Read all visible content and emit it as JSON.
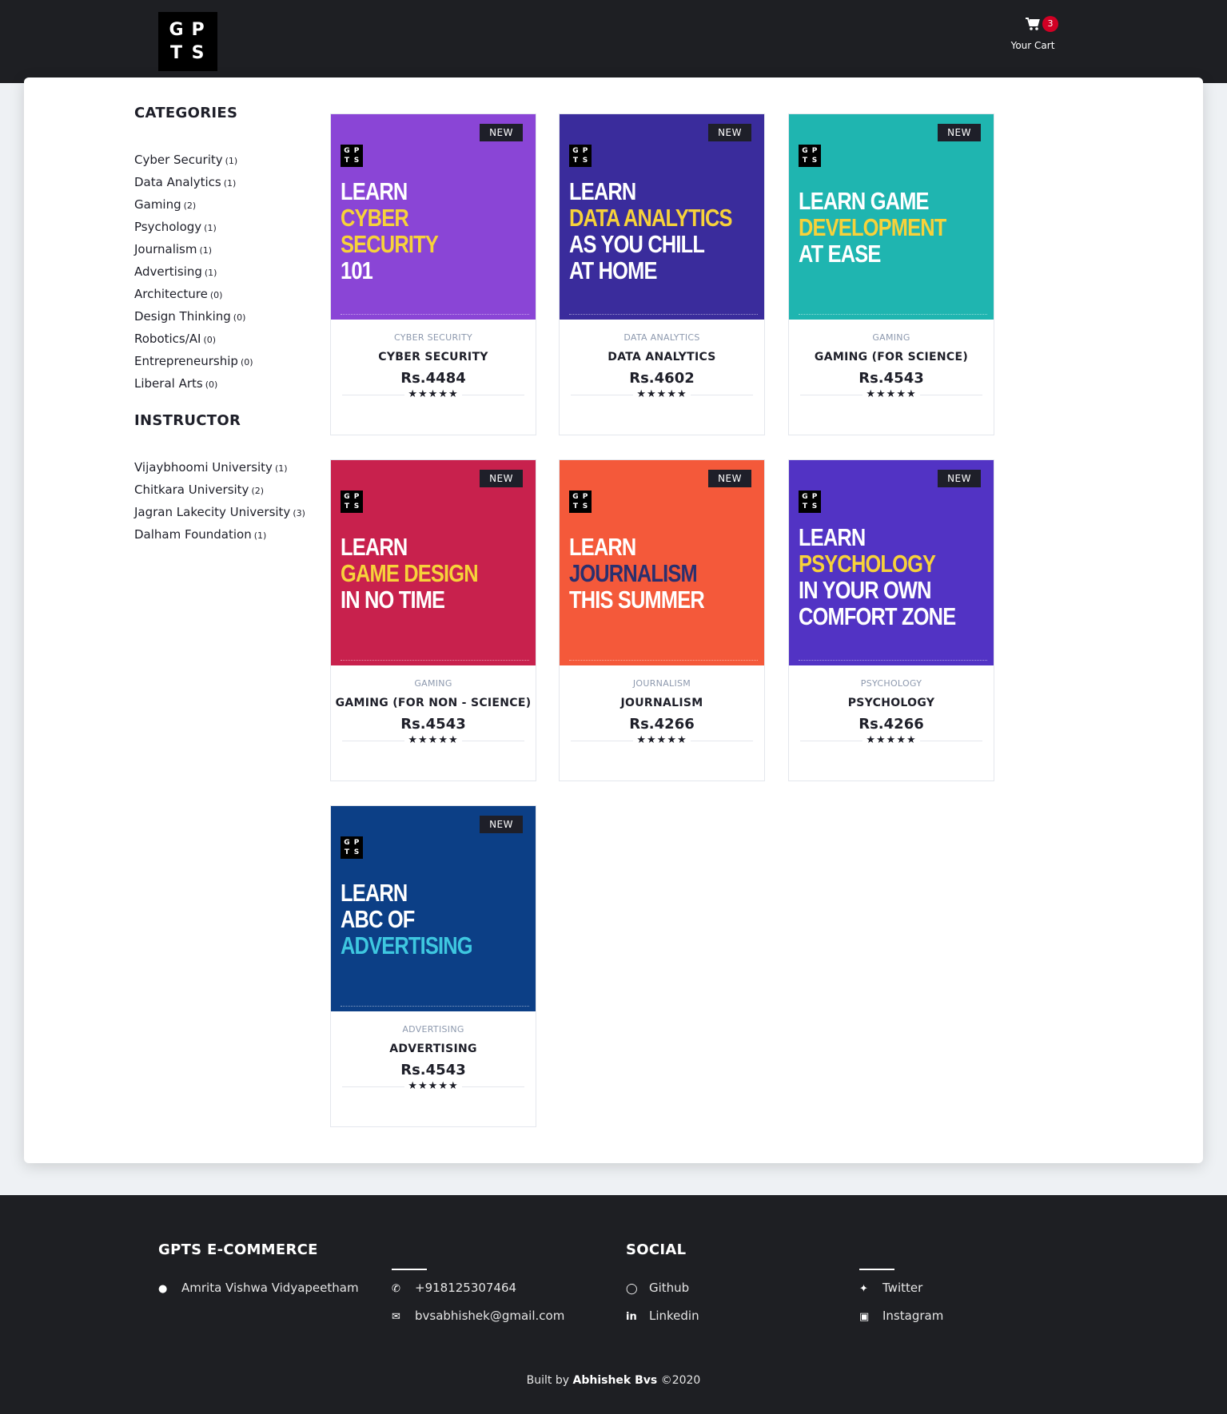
{
  "header": {
    "logo_letters": [
      "G",
      "P",
      "T",
      "S"
    ],
    "cart_count": "3",
    "cart_label": "Your Cart",
    "cart_icon": "shopping-cart-icon"
  },
  "sidebar": {
    "categories_title": "CATEGORIES",
    "categories": [
      {
        "label": "Cyber Security",
        "count": "(1)"
      },
      {
        "label": "Data Analytics",
        "count": "(1)"
      },
      {
        "label": "Gaming",
        "count": "(2)"
      },
      {
        "label": "Psychology",
        "count": "(1)"
      },
      {
        "label": "Journalism",
        "count": "(1)"
      },
      {
        "label": "Advertising",
        "count": "(1)"
      },
      {
        "label": "Architecture",
        "count": "(0)"
      },
      {
        "label": "Design Thinking",
        "count": "(0)"
      },
      {
        "label": "Robotics/AI",
        "count": "(0)"
      },
      {
        "label": "Entrepreneurship",
        "count": "(0)"
      },
      {
        "label": "Liberal Arts",
        "count": "(0)"
      }
    ],
    "instructor_title": "INSTRUCTOR",
    "instructors": [
      {
        "label": "Vijaybhoomi University",
        "count": "(1)"
      },
      {
        "label": "Chitkara University",
        "count": "(2)"
      },
      {
        "label": "Jagran Lakecity University",
        "count": "(3)"
      },
      {
        "label": "Dalham Foundation",
        "count": "(1)"
      }
    ]
  },
  "products": [
    {
      "badge": "NEW",
      "category": "CYBER SECURITY",
      "name": "CYBER SECURITY",
      "price": "Rs.4484",
      "rating": 5,
      "bg": "#8a45d6",
      "poster": [
        "LEARN",
        "CYBER",
        "SECURITY",
        "101"
      ],
      "poster_colors": [
        "#ffffff",
        "#f7d23a",
        "#f7d23a",
        "#ffffff"
      ]
    },
    {
      "badge": "NEW",
      "category": "DATA ANALYTICS",
      "name": "DATA ANALYTICS",
      "price": "Rs.4602",
      "rating": 5,
      "bg": "#3a2c9c",
      "poster": [
        "LEARN",
        "DATA ANALYTICS",
        "AS YOU CHILL",
        "AT HOME"
      ],
      "poster_colors": [
        "#ffffff",
        "#f7d23a",
        "#ffffff",
        "#ffffff"
      ]
    },
    {
      "badge": "NEW",
      "category": "GAMING",
      "name": "GAMING (FOR SCIENCE)",
      "price": "Rs.4543",
      "rating": 5,
      "bg": "#1fb5b0",
      "poster": [
        "LEARN GAME",
        "DEVELOPMENT",
        "AT EASE"
      ],
      "poster_colors": [
        "#ffffff",
        "#f7d23a",
        "#ffffff"
      ]
    },
    {
      "badge": "NEW",
      "category": "GAMING",
      "name": "GAMING (FOR NON - SCIENCE)",
      "price": "Rs.4543",
      "rating": 5,
      "bg": "#c8214d",
      "poster": [
        "LEARN",
        "GAME DESIGN",
        "IN NO TIME"
      ],
      "poster_colors": [
        "#ffffff",
        "#f7d23a",
        "#ffffff"
      ]
    },
    {
      "badge": "NEW",
      "category": "JOURNALISM",
      "name": "JOURNALISM",
      "price": "Rs.4266",
      "rating": 5,
      "bg": "#f4593a",
      "poster": [
        "LEARN",
        "JOURNALISM",
        "THIS SUMMER"
      ],
      "poster_colors": [
        "#ffffff",
        "#2a2f6e",
        "#ffffff"
      ]
    },
    {
      "badge": "NEW",
      "category": "PSYCHOLOGY",
      "name": "PSYCHOLOGY",
      "price": "Rs.4266",
      "rating": 5,
      "bg": "#5233c4",
      "poster": [
        "LEARN",
        "PSYCHOLOGY",
        "IN YOUR OWN",
        "COMFORT ZONE"
      ],
      "poster_colors": [
        "#ffffff",
        "#f7d23a",
        "#ffffff",
        "#ffffff"
      ]
    },
    {
      "badge": "NEW",
      "category": "ADVERTISING",
      "name": "ADVERTISING",
      "price": "Rs.4543",
      "rating": 5,
      "bg": "#0c3f86",
      "poster": [
        "LEARN",
        "ABC OF",
        "ADVERTISING"
      ],
      "poster_colors": [
        "#ffffff",
        "#ffffff",
        "#3ec7e0"
      ]
    }
  ],
  "footer": {
    "about_title": "GPTS E-COMMERCE",
    "address": "Amrita Vishwa Vidyapeetham",
    "phone": "+918125307464",
    "email": "bvsabhishek@gmail.com",
    "social_title": "SOCIAL",
    "github": "Github",
    "linkedin": "Linkedin",
    "twitter": "Twitter",
    "instagram": "Instagram",
    "built_by_prefix": "Built by",
    "author": "Abhishek Bvs",
    "year": "©2020"
  }
}
